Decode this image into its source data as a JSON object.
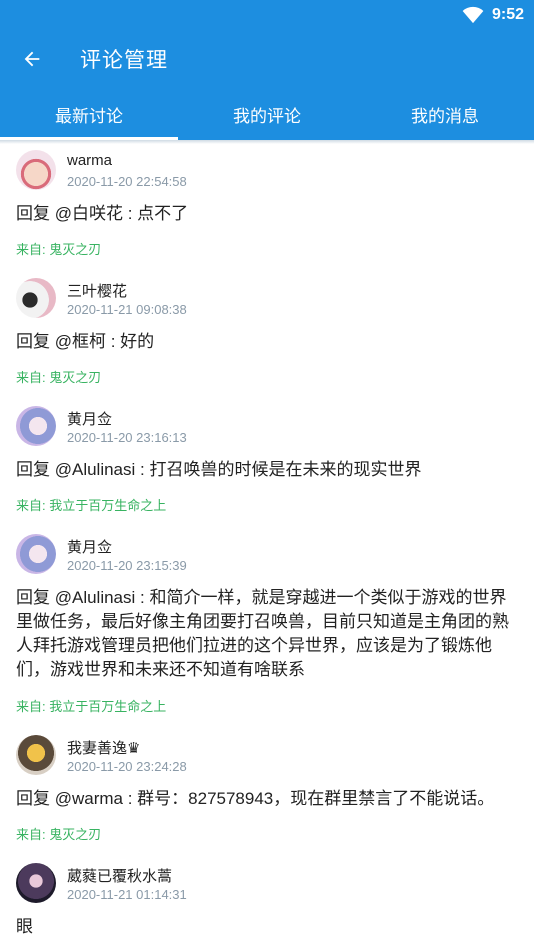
{
  "status_bar": {
    "time": "9:52",
    "icons": [
      "wifi-icon"
    ]
  },
  "toolbar": {
    "title": "评论管理",
    "back_icon": "arrow-left-icon"
  },
  "tabs": [
    {
      "label": "最新讨论",
      "active": true
    },
    {
      "label": "我的评论",
      "active": false
    },
    {
      "label": "我的消息",
      "active": false
    }
  ],
  "colors": {
    "primary": "#1d8ee0",
    "source_green": "#38b361",
    "time_gray": "#8a9aa8"
  },
  "comments": [
    {
      "user": "warma",
      "time": "2020-11-20 22:54:58",
      "content": "回复 @白咲花 : 点不了",
      "source": "来自: 鬼灭之刃"
    },
    {
      "user": "三叶樱花",
      "time": "2020-11-21 09:08:38",
      "content": "回复 @框柯 : 好的",
      "source": "来自: 鬼灭之刃"
    },
    {
      "user": "黄月佥",
      "time": "2020-11-20 23:16:13",
      "content": "回复 @Alulinasi : 打召唤兽的时候是在未来的现实世界",
      "source": "来自: 我立于百万生命之上"
    },
    {
      "user": "黄月佥",
      "time": "2020-11-20 23:15:39",
      "content": "回复 @Alulinasi : 和简介一样，就是穿越进一个类似于游戏的世界里做任务，最后好像主角团要打召唤兽，目前只知道是主角团的熟人拜托游戏管理员把他们拉进的这个异世界，应该是为了锻炼他们，游戏世界和未来还不知道有啥联系",
      "source": "来自: 我立于百万生命之上"
    },
    {
      "user": "我妻善逸♛",
      "time": "2020-11-20 23:24:28",
      "content": "回复 @warma : 群号：827578943，现在群里禁言了不能说话。",
      "source": "来自: 鬼灭之刃"
    },
    {
      "user": "葳蕤已覆秋水蒿",
      "time": "2020-11-21 01:14:31",
      "content": "眼",
      "source": ""
    }
  ]
}
